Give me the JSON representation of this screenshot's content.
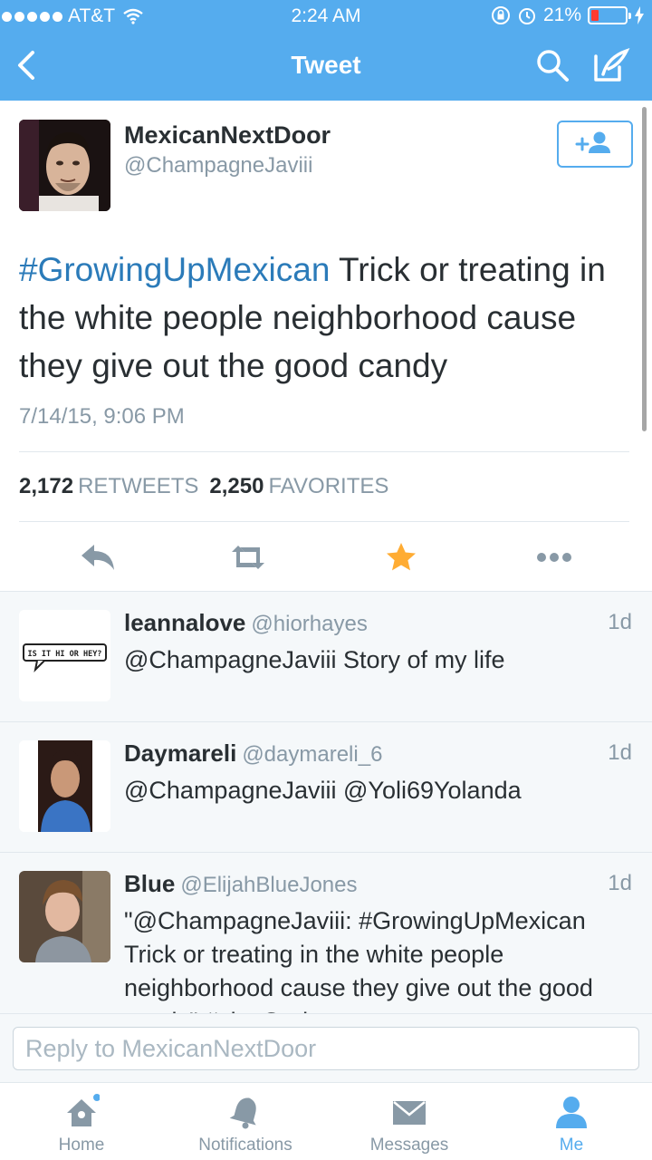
{
  "status_bar": {
    "carrier": "AT&T",
    "time": "2:24 AM",
    "battery_percent": "21%",
    "battery_level": 0.21,
    "signal_bars": 5
  },
  "nav": {
    "title": "Tweet",
    "back_icon": "chevron-left-icon",
    "search_icon": "search-icon",
    "compose_icon": "compose-icon"
  },
  "tweet": {
    "author_name": "MexicanNextDoor",
    "author_handle": "@ChampagneJaviii",
    "hashtag": "#GrowingUpMexican",
    "text": " Trick or treating in the white people neighborhood cause they give out the good candy",
    "timestamp": "7/14/15, 9:06 PM",
    "retweet_count": "2,172",
    "retweet_label": "RETWEETS",
    "favorite_count": "2,250",
    "favorite_label": "FAVORITES",
    "favorited": true
  },
  "replies": [
    {
      "name": "leannalove",
      "handle": "@hiorhayes",
      "time": "1d",
      "text": "@ChampagneJaviii Story of my life",
      "avatar_text": "IS IT HI OR HEY?"
    },
    {
      "name": "Daymareli",
      "handle": "@daymareli_6",
      "time": "1d",
      "text": "@ChampagneJaviii @Yoli69Yolanda"
    },
    {
      "name": "Blue",
      "handle": "@ElijahBlueJones",
      "time": "1d",
      "text": "\"@ChampagneJaviii: #GrowingUpMexican Trick or treating in the white people neighborhood cause they give out the good candy\" #slayGod"
    }
  ],
  "reply_box": {
    "placeholder": "Reply to MexicanNextDoor"
  },
  "tabs": [
    {
      "label": "Home",
      "icon": "home-icon"
    },
    {
      "label": "Notifications",
      "icon": "bell-icon"
    },
    {
      "label": "Messages",
      "icon": "envelope-icon"
    },
    {
      "label": "Me",
      "icon": "person-icon"
    }
  ],
  "colors": {
    "brand": "#55acee",
    "link": "#2b7bb9",
    "star": "#ffac33",
    "muted": "#8899a6"
  }
}
